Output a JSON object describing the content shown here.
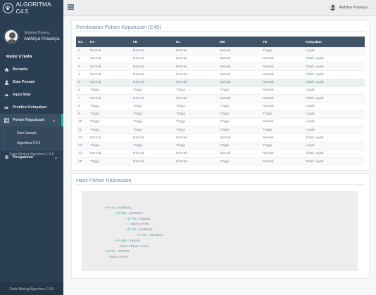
{
  "app": {
    "title": "ALGORITMA C4.5"
  },
  "profile": {
    "welcome": "Selamat Datang,",
    "name": "Aldhitya Prasetya"
  },
  "sidebar": {
    "section": "MENU UTAMA",
    "items": [
      {
        "label": "Beranda",
        "icon": "home-icon"
      },
      {
        "label": "Data Pemain",
        "icon": "user-icon"
      },
      {
        "label": "Input Nilai",
        "icon": "sign-in-icon"
      },
      {
        "label": "Prediksi Kelayakan",
        "icon": "forward-icon"
      },
      {
        "label": "Pohon Keputusan",
        "icon": "table-icon"
      },
      {
        "label": "Pengaturan",
        "icon": "gear-icon"
      }
    ],
    "submenu": [
      "Nilai Sample",
      "Algoritma C4.5"
    ],
    "footer": "Data Mining Algoritma C4.5"
  },
  "topnav": {
    "user": "Aldhitya Prasetya"
  },
  "panel1": {
    "title": "Pembuatan Pohon Keputusan (C45)",
    "columns": [
      "No.",
      "KC",
      "FB",
      "KL",
      "MB",
      "TB",
      "Kelayakan"
    ],
    "rows": [
      [
        "1",
        "Normal",
        "Normal",
        "Normal",
        "Normal",
        "Tinggi",
        "Layak"
      ],
      [
        "2",
        "Normal",
        "Normal",
        "Normal",
        "Normal",
        "Normal",
        "Tidak Layak"
      ],
      [
        "3",
        "Normal",
        "Normal",
        "Normal",
        "Normal",
        "Normal",
        "Tidak Layak"
      ],
      [
        "4",
        "Normal",
        "Normal",
        "Normal",
        "Normal",
        "Normal",
        "Tidak Layak"
      ],
      [
        "5",
        "Normal",
        "Normal",
        "Normal",
        "Normal",
        "Normal",
        "Tidak Layak"
      ],
      [
        "6",
        "Tinggi",
        "Tinggi",
        "Tinggi",
        "Tinggi",
        "Normal",
        "Layak"
      ],
      [
        "7",
        "Normal",
        "Normal",
        "Normal",
        "Normal",
        "Normal",
        "Tidak Layak"
      ],
      [
        "8",
        "Tinggi",
        "Tinggi",
        "Tinggi",
        "Tinggi",
        "Normal",
        "Layak"
      ],
      [
        "9",
        "Tinggi",
        "Tinggi",
        "Tinggi",
        "Tinggi",
        "Tinggi",
        "Layak"
      ],
      [
        "10",
        "Tinggi",
        "Tinggi",
        "Tinggi",
        "Tinggi",
        "Normal",
        "Layak"
      ],
      [
        "11",
        "Tinggi",
        "Tinggi",
        "Tinggi",
        "Tinggi",
        "Tinggi",
        "Layak"
      ],
      [
        "12",
        "Normal",
        "Normal",
        "Normal",
        "Normal",
        "Normal",
        "Tidak Layak"
      ],
      [
        "13",
        "Tinggi",
        "Tinggi",
        "Tinggi",
        "Tinggi",
        "Tinggi",
        "Layak"
      ],
      [
        "14",
        "Normal",
        "Normal",
        "Normal",
        "Normal",
        "Normal",
        "Tidak Layak"
      ],
      [
        "15",
        "Tinggi",
        "Normal",
        "Normal",
        "Tinggi",
        "Normal",
        "Tidak Layak"
      ]
    ]
  },
  "panel2": {
    "title": "Hasil Pohon Keputusan",
    "tree": [
      {
        "indent": 0,
        "bullet": true,
        "attr": "IF FB",
        "val": "= NORMAL"
      },
      {
        "indent": 1,
        "bullet": true,
        "attr": "IF MB",
        "val": "= NORMAL"
      },
      {
        "indent": 2,
        "bullet": true,
        "attr": "IF TB",
        "val": "= TINGGI"
      },
      {
        "indent": 2,
        "bullet": false,
        "attr": "",
        "val": "return LAYAK"
      },
      {
        "indent": 2,
        "bullet": true,
        "attr": "IF TB",
        "val": "= NORMAL"
      },
      {
        "indent": 3,
        "bullet": true,
        "attr": "IF KL",
        "val": "= NORMAL"
      },
      {
        "indent": 1,
        "bullet": true,
        "attr": "IF MB",
        "val": "= TINGGI"
      },
      {
        "indent": 1,
        "bullet": false,
        "attr": "",
        "val": "return TIDAK LAYAK"
      },
      {
        "indent": 0,
        "bullet": true,
        "attr": "IF FB",
        "val": "= TINGGI"
      },
      {
        "indent": 0,
        "bullet": false,
        "attr": "",
        "val": "return LAYAK"
      }
    ]
  },
  "colors": {
    "sidebar": "#2a3f54",
    "accent": "#1abb9c",
    "table_header": "#405467"
  }
}
